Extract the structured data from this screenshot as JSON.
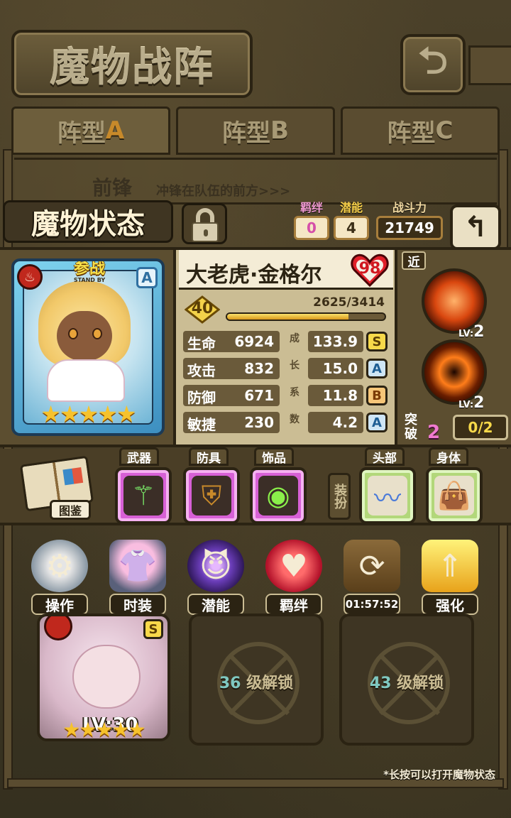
{
  "header": {
    "title": "魔物战阵",
    "back_icon": "back-arrow-icon"
  },
  "tabs": [
    {
      "prefix": "阵型",
      "letter": "A",
      "active": true
    },
    {
      "prefix": "阵型",
      "letter": "B",
      "active": false
    },
    {
      "prefix": "阵型",
      "letter": "C",
      "active": false
    }
  ],
  "vanguard": {
    "label": "前锋",
    "desc": "冲锋在队伍的前方>>>"
  },
  "status": {
    "title": "魔物状态",
    "bond": {
      "label": "羁绊",
      "value": "0"
    },
    "potential": {
      "label": "潜能",
      "value": "4"
    },
    "power": {
      "label": "战斗力",
      "value": "21749"
    }
  },
  "monster": {
    "standby_cn": "参战",
    "standby_en": "STAND BY",
    "rank": "A",
    "stars": "★★★★★",
    "name": "大老虎·金格尔",
    "heart_value": "98",
    "level": "40",
    "exp": "2625/3414",
    "exp_fraction": 0.769,
    "growth_label": [
      "成",
      "长",
      "系",
      "数"
    ],
    "attributes": [
      {
        "name": "生命",
        "value": "6924",
        "growth": "133.9",
        "grade": "S"
      },
      {
        "name": "攻击",
        "value": "832",
        "growth": "15.0",
        "grade": "A"
      },
      {
        "name": "防御",
        "value": "671",
        "growth": "11.8",
        "grade": "B"
      },
      {
        "name": "敏捷",
        "value": "230",
        "growth": "4.2",
        "grade": "A"
      }
    ]
  },
  "skills": {
    "range": "近",
    "items": [
      {
        "lv_label": "LV:",
        "lv": "2",
        "icon": "tiger-skill-icon"
      },
      {
        "lv_label": "LV:",
        "lv": "2",
        "icon": "eye-skill-icon"
      }
    ],
    "breakthrough": {
      "label": "突破",
      "count": "2",
      "progress": "0/2"
    }
  },
  "equipment": {
    "codex_label": "图鉴",
    "slots": [
      {
        "label": "武器",
        "icon": "staff-icon"
      },
      {
        "label": "防具",
        "icon": "armor-icon"
      },
      {
        "label": "饰品",
        "icon": "eye-charm-icon"
      }
    ],
    "dress_label": "装扮",
    "cosmetic": [
      {
        "label": "头部",
        "icon": "ribbon-icon"
      },
      {
        "label": "身体",
        "icon": "bag-icon"
      }
    ]
  },
  "actions": [
    {
      "label": "操作",
      "icon": "gear-icon"
    },
    {
      "label": "时装",
      "icon": "outfit-icon"
    },
    {
      "label": "潜能",
      "icon": "devil-icon"
    },
    {
      "label": "羁绊",
      "icon": "hearts-icon"
    },
    {
      "label": "01:57:52",
      "icon": "refresh-box-icon"
    },
    {
      "label": "强化",
      "icon": "up-arrows-icon"
    }
  ],
  "team": {
    "slot1": {
      "rank": "S",
      "lv": "LV:30",
      "stars": "★★★★★"
    },
    "slot2": {
      "num": "36",
      "text": "级解锁"
    },
    "slot3": {
      "num": "43",
      "text": "级解锁"
    }
  },
  "hint": "*长按可以打开魔物状态"
}
